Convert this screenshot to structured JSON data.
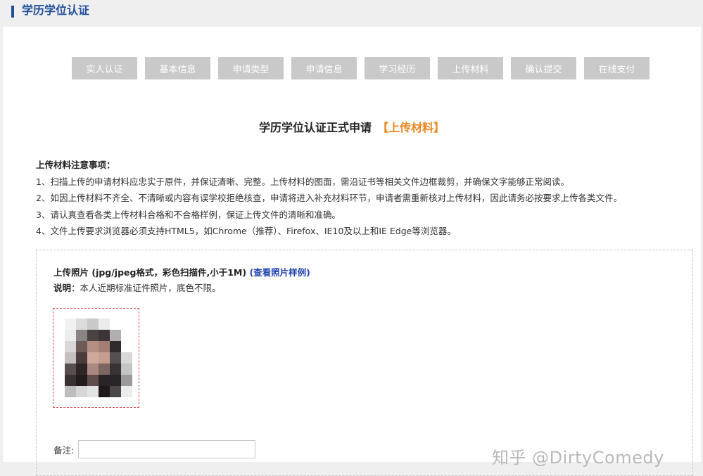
{
  "header": {
    "title": "学历学位认证"
  },
  "steps": [
    "实人认证",
    "基本信息",
    "申请类型",
    "申请信息",
    "学习经历",
    "上传材料",
    "确认提交",
    "在线支付"
  ],
  "page_heading": {
    "main": "学历学位认证正式申请",
    "stage": "【上传材料】"
  },
  "notes": {
    "title": "上传材料注意事项：",
    "items": [
      "1、扫描上传的申请材料应忠实于原件，并保证清晰、完整。上传材料的图面，需沿证书等相关文件边框裁剪，并确保文字能够正常阅读。",
      "2、如因上传材料不齐全、不清晰或内容有误学校拒绝核查，申请将进入补充材料环节，申请者需重新核对上传材料，因此请务必按要求上传各类文件。",
      "3、请认真查看各类上传材料合格和不合格样例，保证上传文件的清晰和准确。",
      "4、文件上传要求浏览器必须支持HTML5，如Chrome（推荐）、Firefox、IE10及以上和IE Edge等浏览器。"
    ]
  },
  "upload": {
    "title": "上传照片 (jpg/jpeg格式，彩色扫描件,小于1M)",
    "sample_link": "(查看照片样例)",
    "desc_label": "说明",
    "desc_text": "：本人近期标准证件照片，底色不限。",
    "remark_label": "备注:",
    "remark_value": ""
  },
  "watermark": "知乎 @DirtyComedy",
  "colors": {
    "brand": "#1f4e9a",
    "highlight": "#e8861e",
    "step_bg": "#c9c9c9",
    "link": "#1e3fb0"
  }
}
